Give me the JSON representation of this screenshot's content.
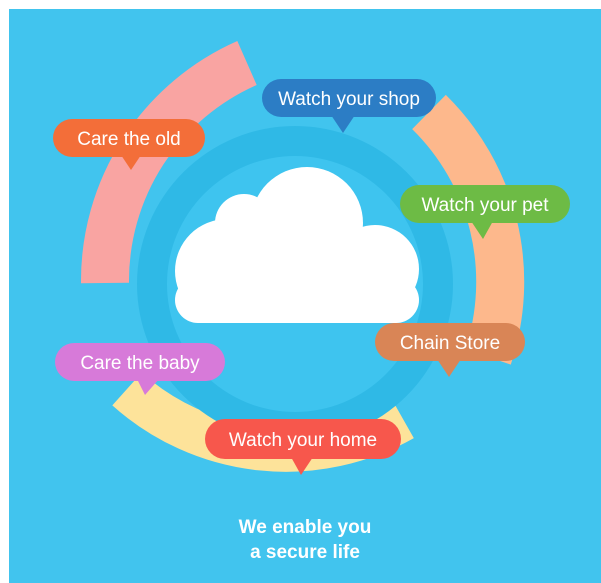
{
  "colors": {
    "background": "#41c4ee",
    "inner_ring": "#2fb9e6",
    "inner_disc": "#3ec4ef",
    "cloud": "#ffffff",
    "arc_pink": "#f9a4a2",
    "arc_peach": "#fdb88c",
    "arc_yellow": "#fde39a"
  },
  "icons": {
    "center": "cloud-icon"
  },
  "bubbles": {
    "care_old": {
      "label": "Care the old",
      "color": "#f36e39"
    },
    "watch_shop": {
      "label": "Watch your shop",
      "color": "#2c7dc5"
    },
    "watch_pet": {
      "label": "Watch your pet",
      "color": "#6dbb45"
    },
    "chain_store": {
      "label": "Chain Store",
      "color": "#d98556"
    },
    "care_baby": {
      "label": "Care the baby",
      "color": "#d77ad9"
    },
    "watch_home": {
      "label": "Watch your home",
      "color": "#f7574c"
    }
  },
  "tagline": {
    "line1": "We enable you",
    "line2": "a secure life"
  }
}
